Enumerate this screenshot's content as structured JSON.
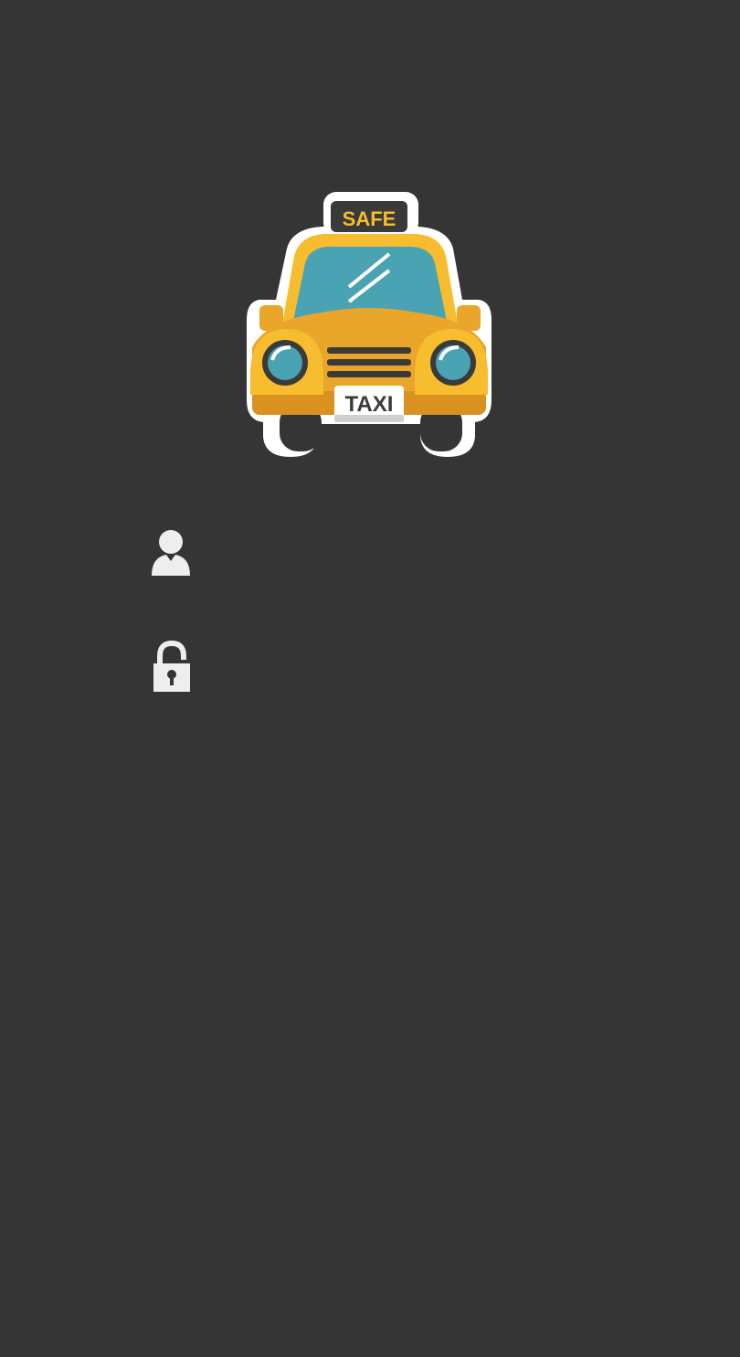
{
  "logo": {
    "roof_sign_text": "SAFE",
    "plate_text": "TAXI"
  },
  "login_form": {
    "username": {
      "icon": "user-icon",
      "value": "",
      "placeholder": ""
    },
    "password": {
      "icon": "lock-icon",
      "value": "",
      "placeholder": ""
    }
  },
  "colors": {
    "background": "#353535",
    "taxi_yellow": "#f7bd2e",
    "taxi_shadow": "#d9921f",
    "windshield": "#4aa3b3",
    "outline": "#ffffff",
    "icon": "#eeeeee"
  }
}
